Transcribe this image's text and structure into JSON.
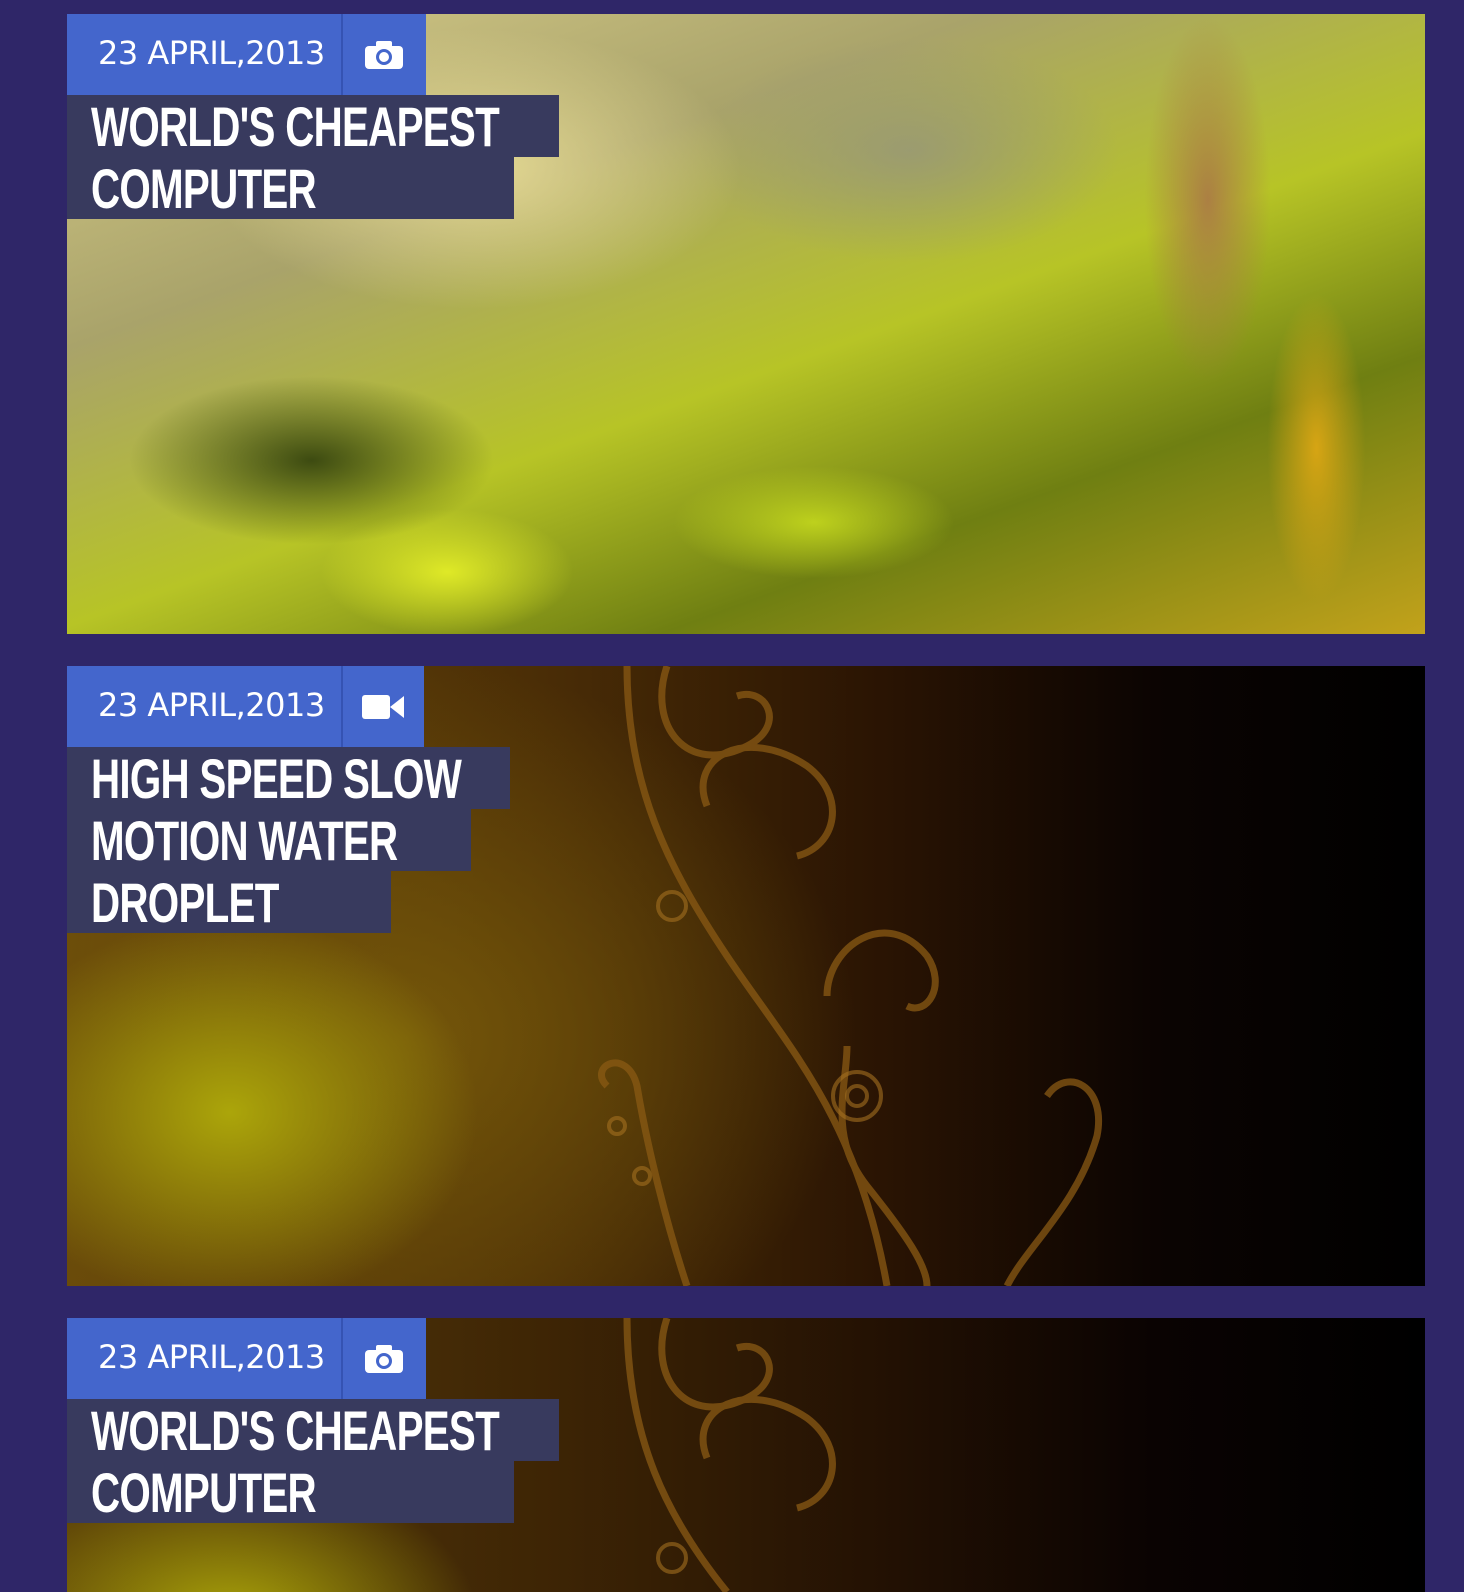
{
  "posts": [
    {
      "date": "23 APRIL,2013",
      "media_icon": "camera-icon",
      "title_lines": [
        "WORLD'S CHEAPEST",
        "COMPUTER"
      ],
      "background": "blurred-yellow-moss"
    },
    {
      "date": "23 APRIL,2013",
      "media_icon": "video-camera-icon",
      "title_lines": [
        "HIGH SPEED SLOW",
        "MOTION WATER",
        "DROPLET"
      ],
      "background": "dark-gold-swirl"
    },
    {
      "date": "23 APRIL,2013",
      "media_icon": "camera-icon",
      "title_lines": [
        "WORLD'S CHEAPEST",
        "COMPUTER"
      ],
      "background": "dark-gold-swirl"
    }
  ],
  "colors": {
    "page_background": "#2f2668",
    "meta_bar": "#4466cc",
    "title_background": "#383a5e",
    "text": "#ffffff"
  }
}
